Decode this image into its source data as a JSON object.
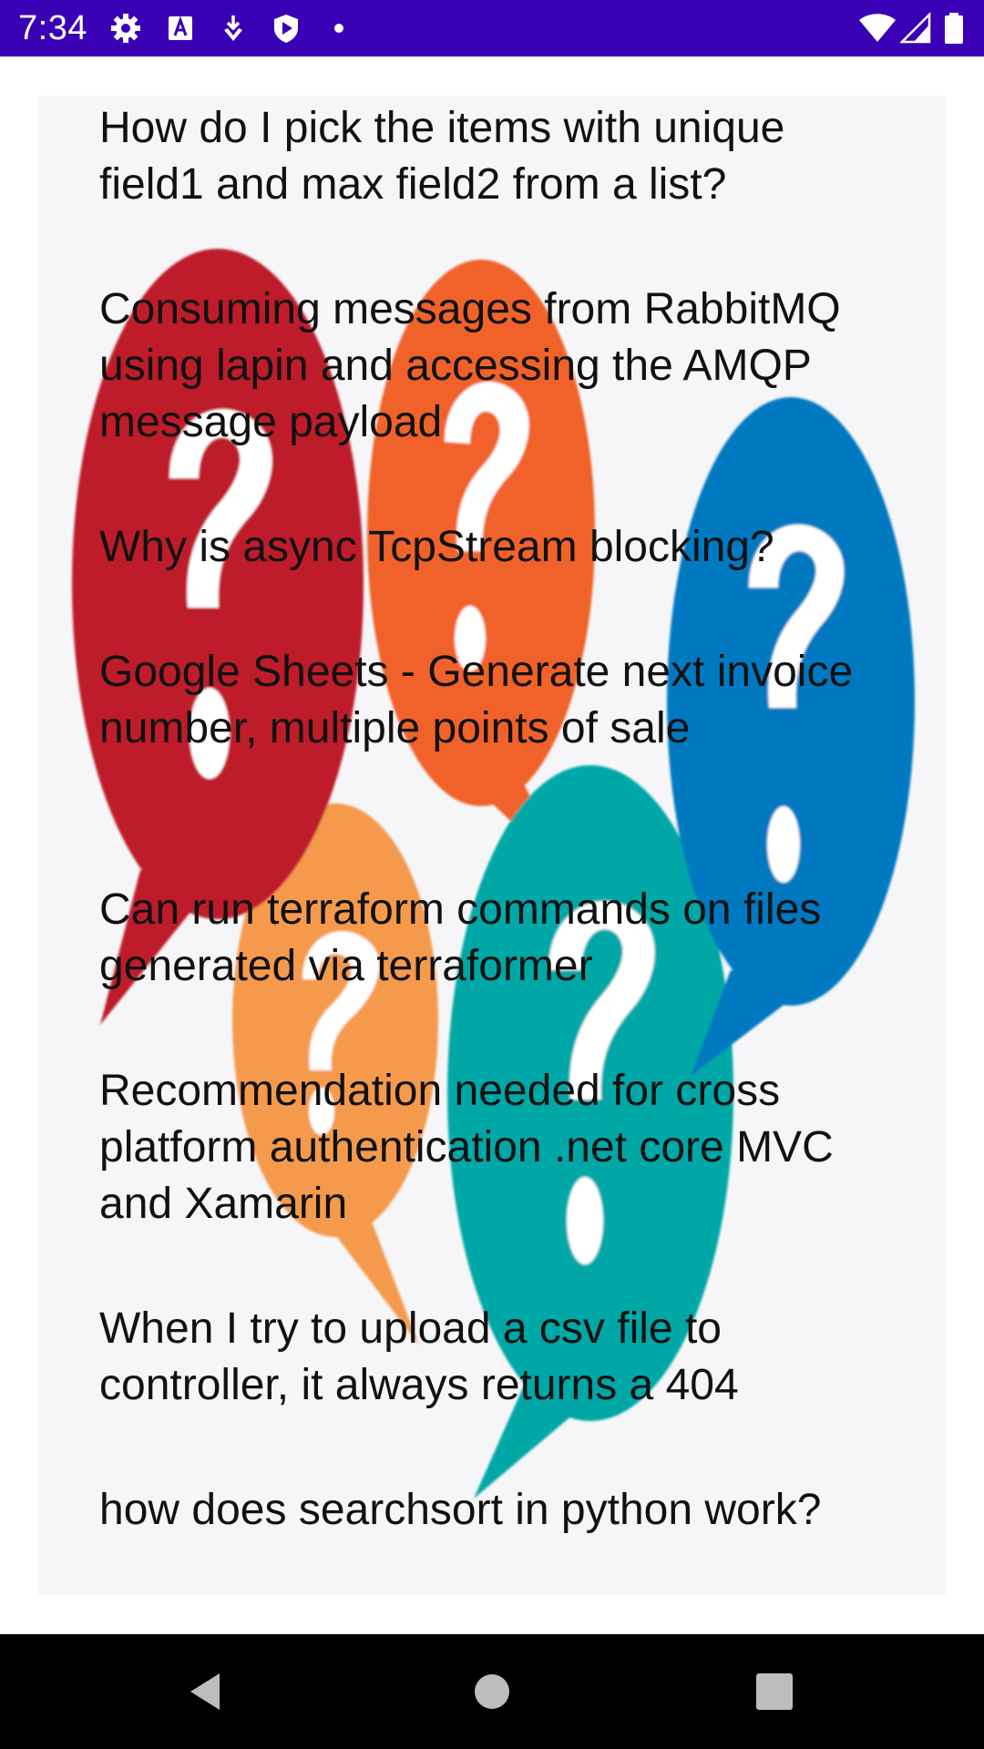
{
  "status_bar": {
    "time": "7:34",
    "background_color": "#3a00b5",
    "left_icons": [
      "gear-icon",
      "text-a-icon",
      "download-shield-icon",
      "play-shield-icon",
      "dot-icon"
    ],
    "right_icons": [
      "wifi-icon",
      "signal-icon",
      "battery-icon"
    ]
  },
  "questions": [
    {
      "title": "How do I pick the items with unique field1 and max field2 from a list?"
    },
    {
      "title": "Consuming messages from RabbitMQ using lapin and accessing the AMQP message payload"
    },
    {
      "title": "Why is async TcpStream blocking?"
    },
    {
      "title": "Google Sheets - Generate next invoice number, multiple points of sale"
    },
    {
      "title": "Can run terraform commands on files generated via terraformer"
    },
    {
      "title": "Recommendation needed for cross platform authentication .net core MVC and Xamarin"
    },
    {
      "title": "When I try to upload a csv file to controller, it always returns a 404"
    },
    {
      "title": "how does searchsort in python work?"
    }
  ],
  "background_art": {
    "description_icons": [
      "question-bubble-icon"
    ],
    "bubble_colors": [
      "#be1a2b",
      "#f0622a",
      "#0079c1",
      "#f59a4e",
      "#00a7a7"
    ]
  },
  "nav_bar": {
    "buttons": [
      "back-icon",
      "home-icon",
      "recents-icon"
    ]
  }
}
